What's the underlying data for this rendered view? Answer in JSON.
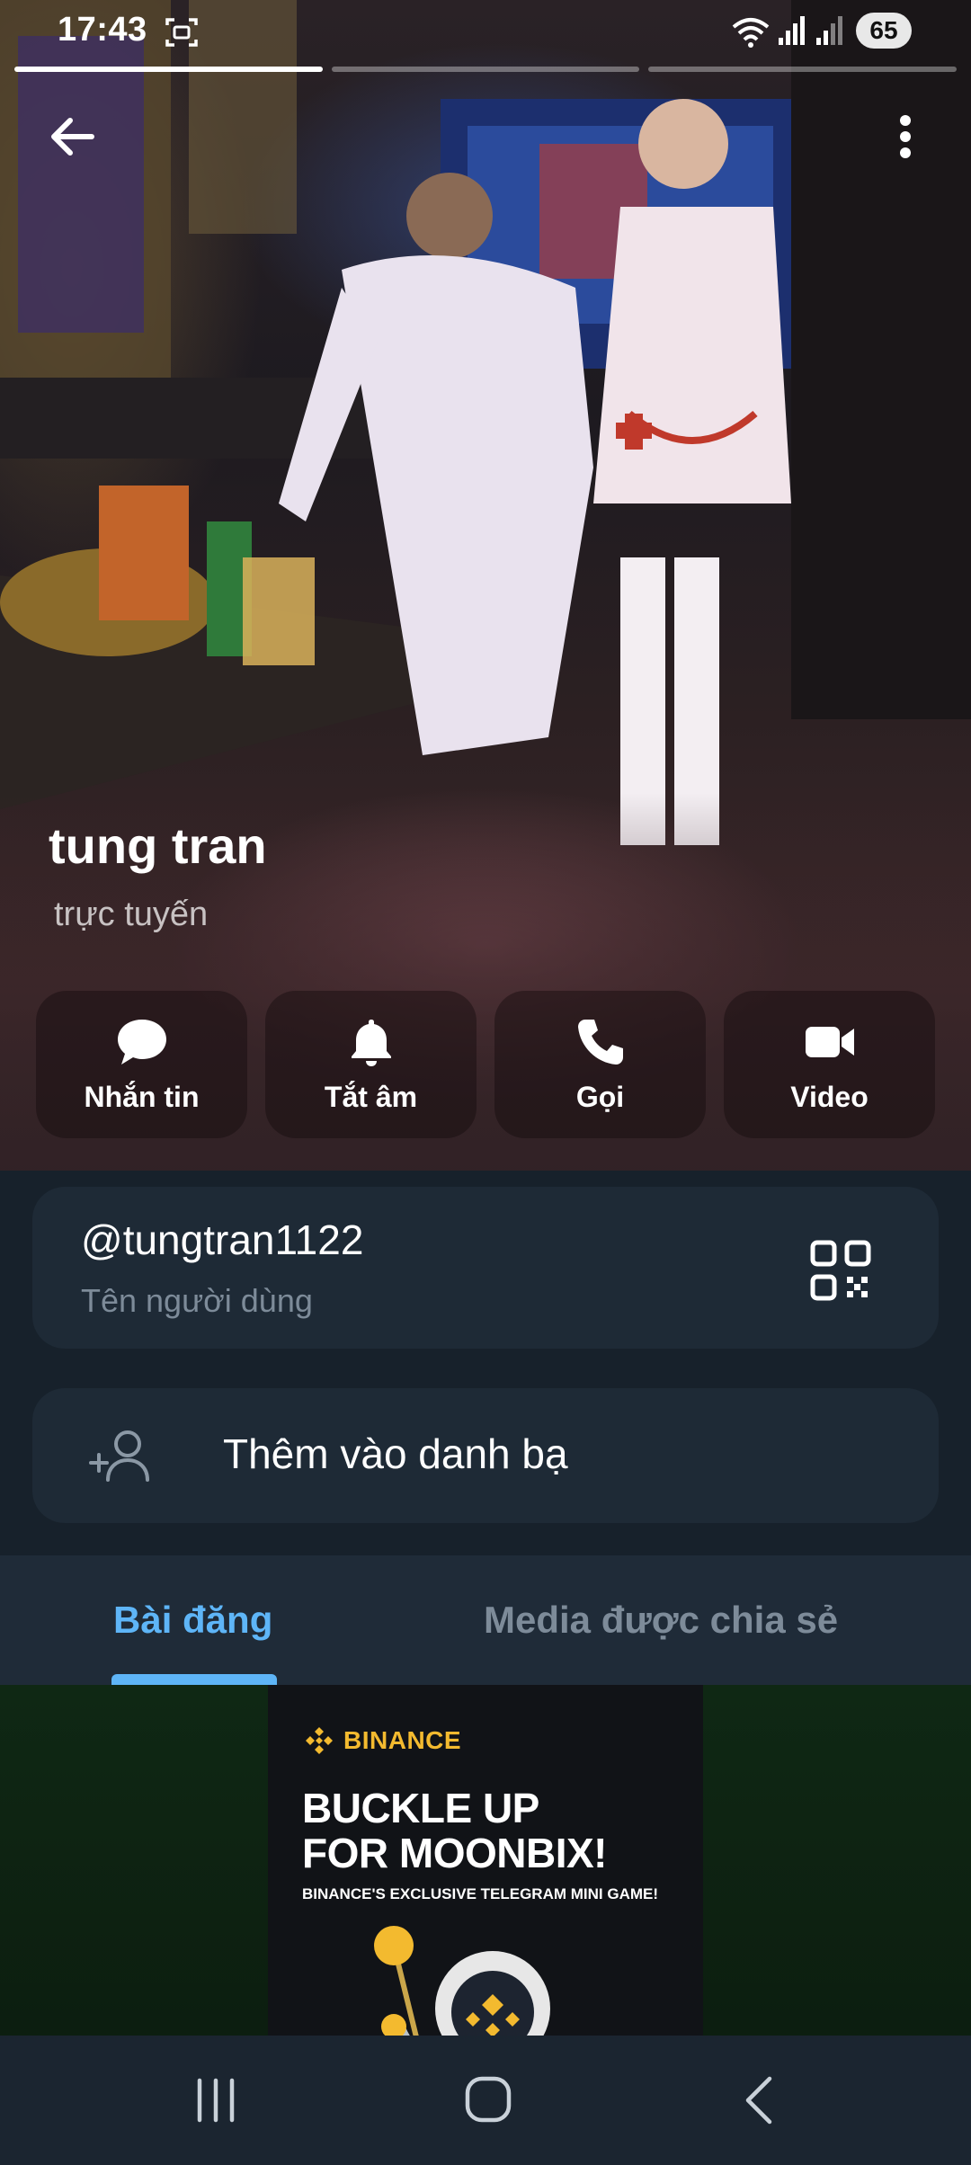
{
  "status_bar": {
    "time": "17:43",
    "battery": "65",
    "icons": [
      "screen-capture-icon",
      "wifi-icon",
      "signal-icon",
      "signal-icon"
    ]
  },
  "story": {
    "segments": 3,
    "active_segment": 1
  },
  "header": {
    "back_icon": "arrow-left-icon",
    "menu_icon": "more-vertical-icon"
  },
  "profile": {
    "name": "tung tran",
    "status": "trực tuyến"
  },
  "actions": [
    {
      "label": "Nhắn tin",
      "icon": "message-bubble-icon"
    },
    {
      "label": "Tắt âm",
      "icon": "bell-icon"
    },
    {
      "label": "Gọi",
      "icon": "phone-icon"
    },
    {
      "label": "Video",
      "icon": "video-camera-icon"
    }
  ],
  "username_card": {
    "value": "@tungtran1122",
    "caption": "Tên người dùng",
    "icon": "qr-code-icon"
  },
  "add_contact": {
    "label": "Thêm vào danh bạ",
    "icon": "add-person-icon"
  },
  "tabs": [
    {
      "label": "Bài đăng",
      "active": true
    },
    {
      "label": "Media được chia sẻ",
      "active": false
    }
  ],
  "ad": {
    "brand": "BINANCE",
    "headline_1": "BUCKLE UP",
    "headline_2": "FOR MOONBIX!",
    "subtext": "BINANCE'S EXCLUSIVE TELEGRAM MINI GAME!",
    "brand_color": "#f3ba2f"
  },
  "nav_bar": {
    "icons": [
      "recent-apps-icon",
      "home-icon",
      "back-icon"
    ]
  },
  "colors": {
    "accent": "#5eb5f7",
    "card_bg": "#1e2a36",
    "page_bg": "#17212b",
    "muted_text": "#7d8b99"
  }
}
